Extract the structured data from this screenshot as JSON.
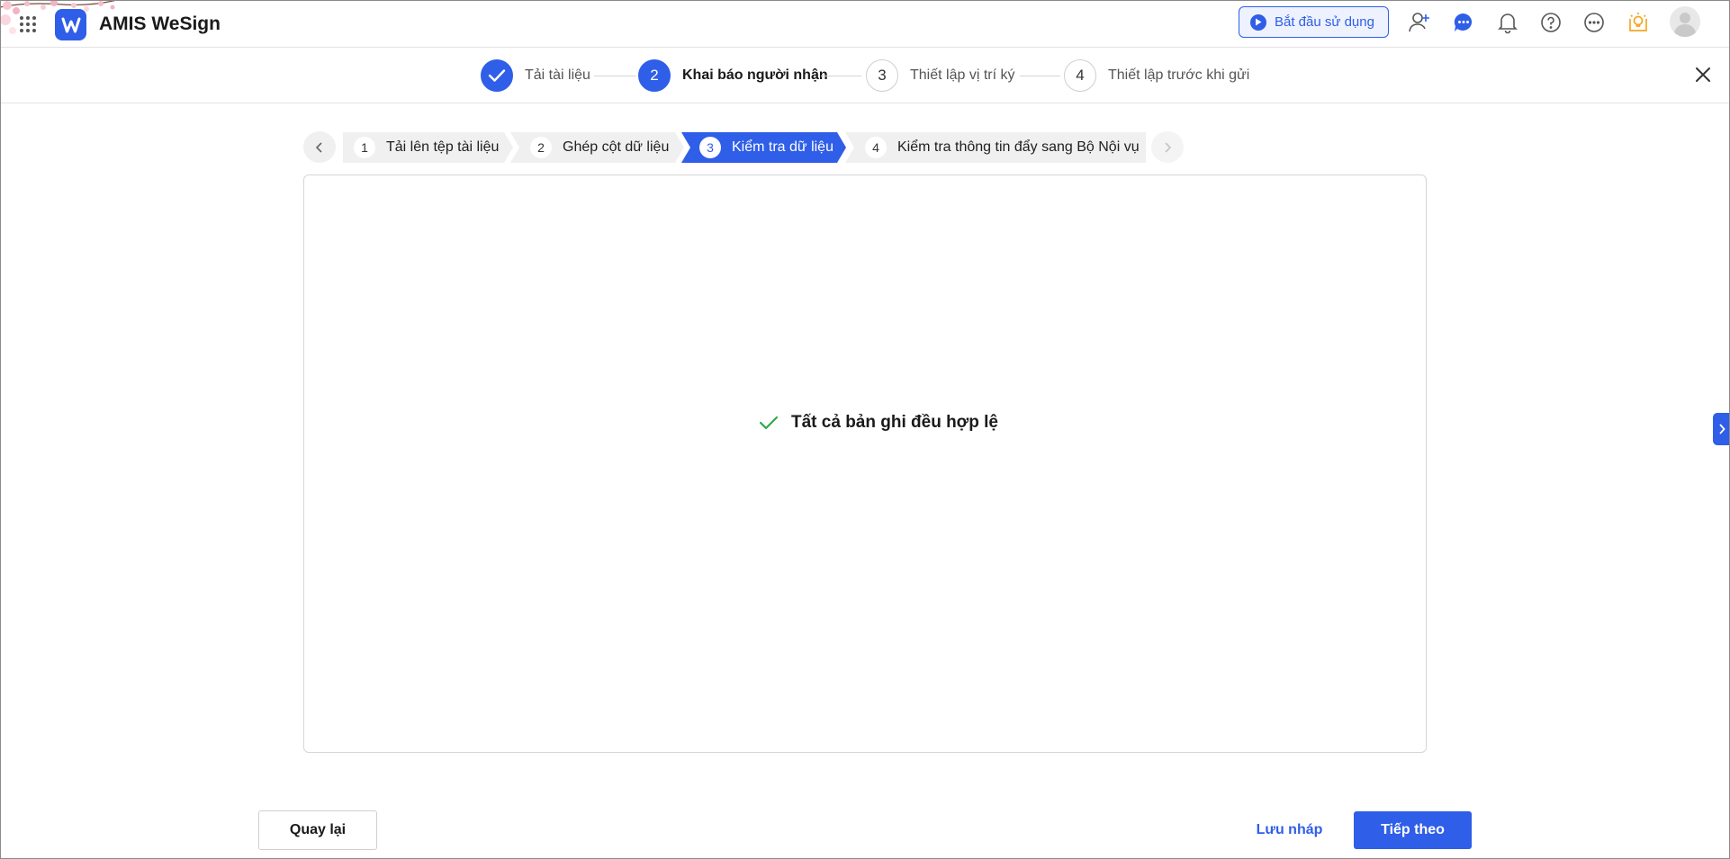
{
  "header": {
    "app_title": "AMIS WeSign",
    "start_button": "Bắt đầu sử dụng",
    "icons": [
      "apps-grid-icon",
      "add-user-icon",
      "chat-icon",
      "bell-icon",
      "help-icon",
      "more-icon",
      "lightbulb-icon",
      "avatar"
    ]
  },
  "wizard": {
    "steps": [
      {
        "number": "1",
        "label": "Tải tài liệu",
        "state": "done"
      },
      {
        "number": "2",
        "label": "Khai báo người nhận",
        "state": "active"
      },
      {
        "number": "3",
        "label": "Thiết lập vị trí ký",
        "state": "pending"
      },
      {
        "number": "4",
        "label": "Thiết lập trước khi gửi",
        "state": "pending"
      }
    ]
  },
  "substeps": [
    {
      "number": "1",
      "label": "Tải lên tệp tài liệu",
      "active": false
    },
    {
      "number": "2",
      "label": "Ghép cột dữ liệu",
      "active": false
    },
    {
      "number": "3",
      "label": "Kiểm tra dữ liệu",
      "active": true
    },
    {
      "number": "4",
      "label": "Kiểm tra thông tin đẩy sang Bộ Nội vụ",
      "active": false
    }
  ],
  "content": {
    "valid_message": "Tất cả bản ghi đều hợp lệ"
  },
  "footer": {
    "back_label": "Quay lại",
    "draft_label": "Lưu nháp",
    "next_label": "Tiếp theo"
  },
  "colors": {
    "primary": "#2f5ee8",
    "success": "#2eaa4a",
    "substep_bg": "#f0f0f0"
  }
}
